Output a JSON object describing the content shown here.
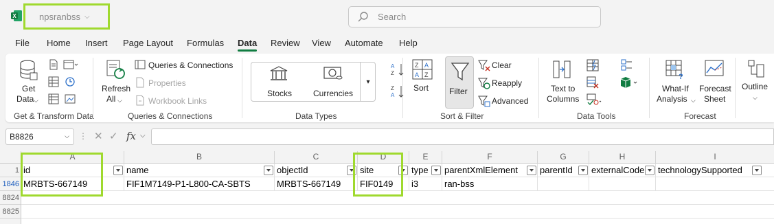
{
  "title_bar": {
    "file_name": "npsranbss",
    "search_placeholder": "Search"
  },
  "tabs": [
    "File",
    "Home",
    "Insert",
    "Page Layout",
    "Formulas",
    "Data",
    "Review",
    "View",
    "Automate",
    "Help"
  ],
  "active_tab": "Data",
  "ribbon": {
    "get_transform": {
      "get_data": "Get",
      "get_data2": "Data",
      "label": "Get & Transform Data"
    },
    "queries": {
      "refresh": "Refresh",
      "refresh_all": "All",
      "queries_connections": "Queries & Connections",
      "properties": "Properties",
      "workbook_links": "Workbook Links",
      "label": "Queries & Connections"
    },
    "data_types": {
      "stocks": "Stocks",
      "currencies": "Currencies",
      "label": "Data Types"
    },
    "sort_filter": {
      "sort": "Sort",
      "filter": "Filter",
      "clear": "Clear",
      "reapply": "Reapply",
      "advanced": "Advanced",
      "label": "Sort & Filter"
    },
    "data_tools": {
      "text_to": "Text to",
      "columns": "Columns",
      "label": "Data Tools"
    },
    "forecast": {
      "what_if": "What-If",
      "analysis": "Analysis",
      "forecast_sheet1": "Forecast",
      "forecast_sheet2": "Sheet",
      "label": "Forecast"
    },
    "outline": {
      "label": "Outline"
    }
  },
  "formula_bar": {
    "name_box": "B8826",
    "value": ""
  },
  "grid": {
    "columns": [
      "A",
      "B",
      "C",
      "D",
      "E",
      "F",
      "G",
      "H",
      "I"
    ],
    "rows": [
      "1",
      "1846",
      "8824",
      "8825"
    ],
    "headers": [
      "id",
      "name",
      "objectId",
      "site",
      "type",
      "parentXmlElement",
      "parentId",
      "externalCode",
      "technologySupported"
    ],
    "row_1846": [
      "MRBTS-667149",
      "FIF1M7149-P1-L800-CA-SBTS",
      "MRBTS-667149",
      "FIF0149",
      "i3",
      "ran-bss",
      "",
      "",
      ""
    ]
  },
  "colors": {
    "accent": "#107c41",
    "highlight": "#9fd92e",
    "selected_row": "#185abd"
  }
}
